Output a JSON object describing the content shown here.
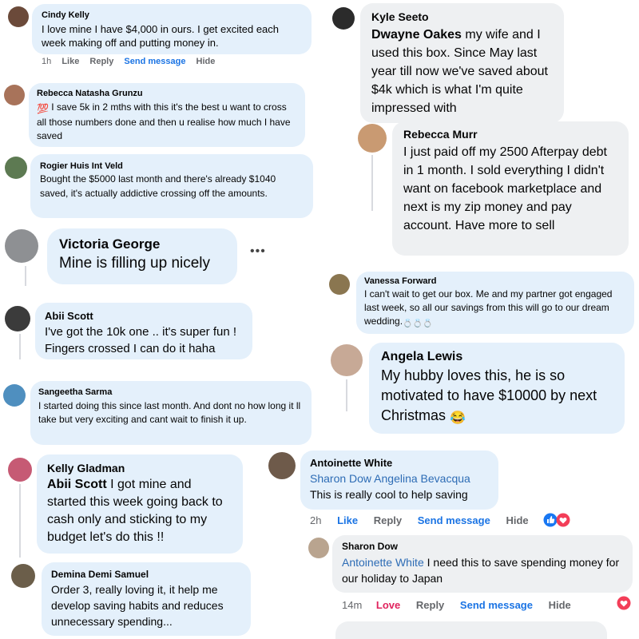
{
  "left": {
    "c1": {
      "name": "Cindy Kelly",
      "text": "I love mine I have $4,000 in ours. I get excited each week making off and putting money in.",
      "actions": {
        "time": "1h",
        "like": "Like",
        "reply": "Reply",
        "send": "Send message",
        "hide": "Hide"
      }
    },
    "c2": {
      "name": "Rebecca Natasha Grunzu",
      "emoji": "💯",
      "text": " I save 5k in 2 mths with this it's the best u want to cross all those numbers done and then u realise how much I have saved"
    },
    "c3": {
      "name": "Rogier Huis Int Veld",
      "text": "Bought the $5000 last month and there's already $1040 saved, it's actually addictive crossing off the amounts."
    },
    "c4": {
      "name": "Victoria George",
      "text": "Mine is filling up nicely",
      "more": "•••"
    },
    "c5": {
      "name": "Abii Scott",
      "text": "I've got the 10k one .. it's super fun ! Fingers crossed I can do it haha"
    },
    "c6": {
      "name": "Sangeetha Sarma",
      "text": "I started doing this since last month. And dont no how long it ll take but very exciting and cant wait to finish it up."
    },
    "c7": {
      "name": "Kelly Gladman",
      "tag": "Abii Scott",
      "text": " I got mine and started this week going back to cash only and sticking to my budget let's do this !!"
    },
    "c8": {
      "name": "Demina Demi Samuel",
      "text": "Order 3, really loving it, it help me develop saving habits and reduces unnecessary spending..."
    }
  },
  "right": {
    "c1": {
      "name": "Kyle Seeto",
      "tag": "Dwayne Oakes",
      "text": " my wife and I used this box. Since May last year till now we've saved about $4k which is what I'm quite impressed with"
    },
    "c2": {
      "name": "Rebecca Murr",
      "text": "I just paid off my 2500 Afterpay debt in 1 month. I sold everything I didn't want on facebook marketplace and next is my zip money and pay account. Have more to sell"
    },
    "c3": {
      "name": "Vanessa Forward",
      "text": "I can't wait to get our box. Me and my partner got engaged last week, so all our savings from this will go to our dream wedding.",
      "emoji": " 💍💍💍"
    },
    "c4": {
      "name": "Angela Lewis",
      "text": "My hubby loves this, he is so motivated to have $10000 by next Christmas ",
      "emoji": "😂"
    },
    "c5": {
      "name": "Antoinette White",
      "tag": "Sharon Dow Angelina Bevacqua",
      "text": "This is really cool to help saving",
      "actions": {
        "time": "2h",
        "like": "Like",
        "reply": "Reply",
        "send": "Send message",
        "hide": "Hide",
        "count": "2"
      }
    },
    "c6": {
      "name": "Sharon Dow",
      "tag": "Antoinette White",
      "text": " I need this to save spending money for our holiday to Japan",
      "actions": {
        "time": "14m",
        "love": "Love",
        "reply": "Reply",
        "send": "Send message",
        "hide": "Hide"
      }
    }
  },
  "colors": {
    "bubble_blue": "#e4f0fb",
    "link_blue": "#1b74e4",
    "love_red": "#e0245e"
  }
}
